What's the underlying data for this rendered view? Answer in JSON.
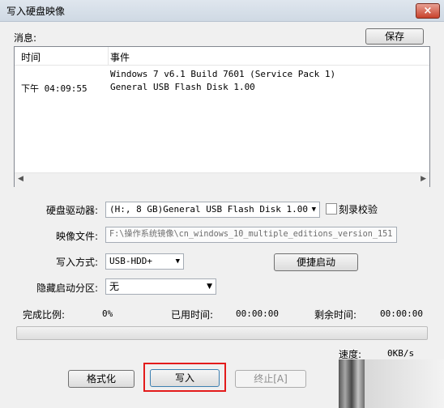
{
  "window": {
    "title": "写入硬盘映像",
    "close_glyph": "×"
  },
  "messages": {
    "label": "消息:",
    "save_label": "保存",
    "columns": [
      "时间",
      "事件"
    ],
    "rows": [
      {
        "time": "",
        "event": "Windows 7 v6.1 Build 7601 (Service Pack 1)"
      },
      {
        "time": "下午 04:09:55",
        "event": "General USB Flash Disk  1.00"
      }
    ]
  },
  "form": {
    "drive_label": "硬盘驱动器:",
    "drive_value": "(H:, 8 GB)General USB Flash Disk  1.00",
    "verify_label": "刻录校验",
    "image_label": "映像文件:",
    "image_value": "F:\\操作系统镜像\\cn_windows_10_multiple_editions_version_151",
    "method_label": "写入方式:",
    "method_value": "USB-HDD+",
    "quick_boot_label": "便捷启动",
    "hidden_label": "隐藏启动分区:",
    "hidden_value": "无"
  },
  "progress": {
    "complete_label": "完成比例:",
    "complete_value": "0%",
    "elapsed_label": "已用时间:",
    "elapsed_value": "00:00:00",
    "remaining_label": "剩余时间:",
    "remaining_value": "00:00:00",
    "speed_label": "速度:",
    "speed_value": "0KB/s",
    "fraction": 0
  },
  "buttons": {
    "format": "格式化",
    "write": "写入",
    "stop": "终止[A]"
  },
  "colors": {
    "highlight_box": "#e31b1b"
  }
}
